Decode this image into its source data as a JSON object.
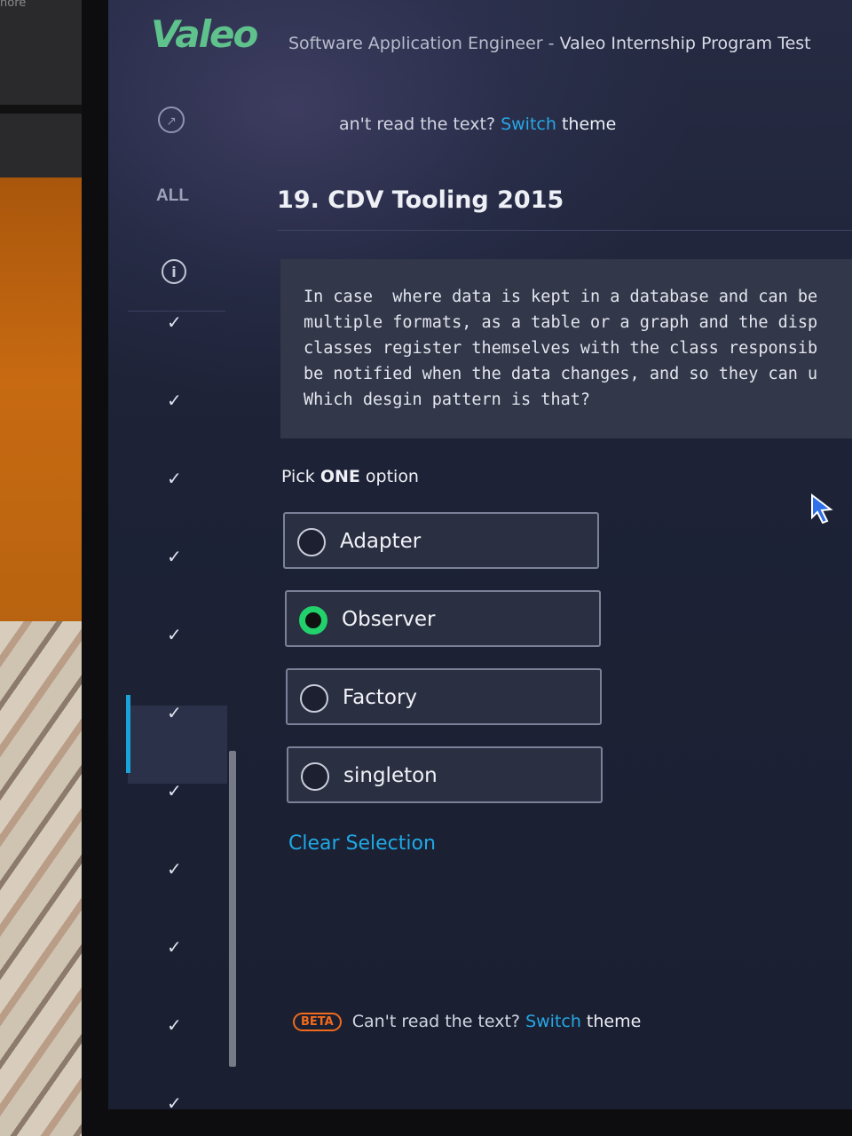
{
  "background": {
    "corner_text": "nore"
  },
  "header": {
    "logo_text": "Valeo",
    "title_prefix": "Software Application Engineer - ",
    "title_main": "Valeo Internship Program Test"
  },
  "sidebar": {
    "all_label": "ALL",
    "info_icon": "info-icon",
    "nav_icon": "arrow-circle-icon",
    "items": [
      {
        "icon": "check-icon",
        "mark": "✓"
      },
      {
        "icon": "check-icon",
        "mark": "✓"
      },
      {
        "icon": "check-icon",
        "mark": "✓"
      },
      {
        "icon": "check-icon",
        "mark": "✓"
      },
      {
        "icon": "check-icon",
        "mark": "✓"
      },
      {
        "icon": "check-icon",
        "mark": "✓",
        "active": true
      },
      {
        "icon": "check-icon",
        "mark": "✓"
      },
      {
        "icon": "check-icon",
        "mark": "✓"
      },
      {
        "icon": "check-icon",
        "mark": "✓"
      },
      {
        "icon": "check-icon",
        "mark": "✓"
      },
      {
        "icon": "check-icon",
        "mark": "✓"
      }
    ]
  },
  "theme_notice": {
    "top_text": "an't read the text? ",
    "text": "Can't read the text? ",
    "link": "Switch",
    "suffix": " theme",
    "badge": "BETA"
  },
  "question": {
    "title": "19. CDV Tooling 2015",
    "body": "In case  where data is kept in a database and can be\nmultiple formats, as a table or a graph and the disp\nclasses register themselves with the class responsib\nbe notified when the data changes, and so they can u\nWhich desgin pattern is that?",
    "pick_prefix": "Pick ",
    "pick_strong": "ONE",
    "pick_suffix": " option",
    "options": [
      {
        "label": "Adapter",
        "selected": false
      },
      {
        "label": "Observer",
        "selected": true
      },
      {
        "label": "Factory",
        "selected": false
      },
      {
        "label": "singleton",
        "selected": false
      }
    ],
    "clear_label": "Clear Selection"
  },
  "colors": {
    "accent_link": "#26a8e6",
    "selected_radio": "#22d16b",
    "beta_badge": "#f26a1b",
    "logo": "#5fc28c",
    "active_marker": "#1aa3d8"
  }
}
